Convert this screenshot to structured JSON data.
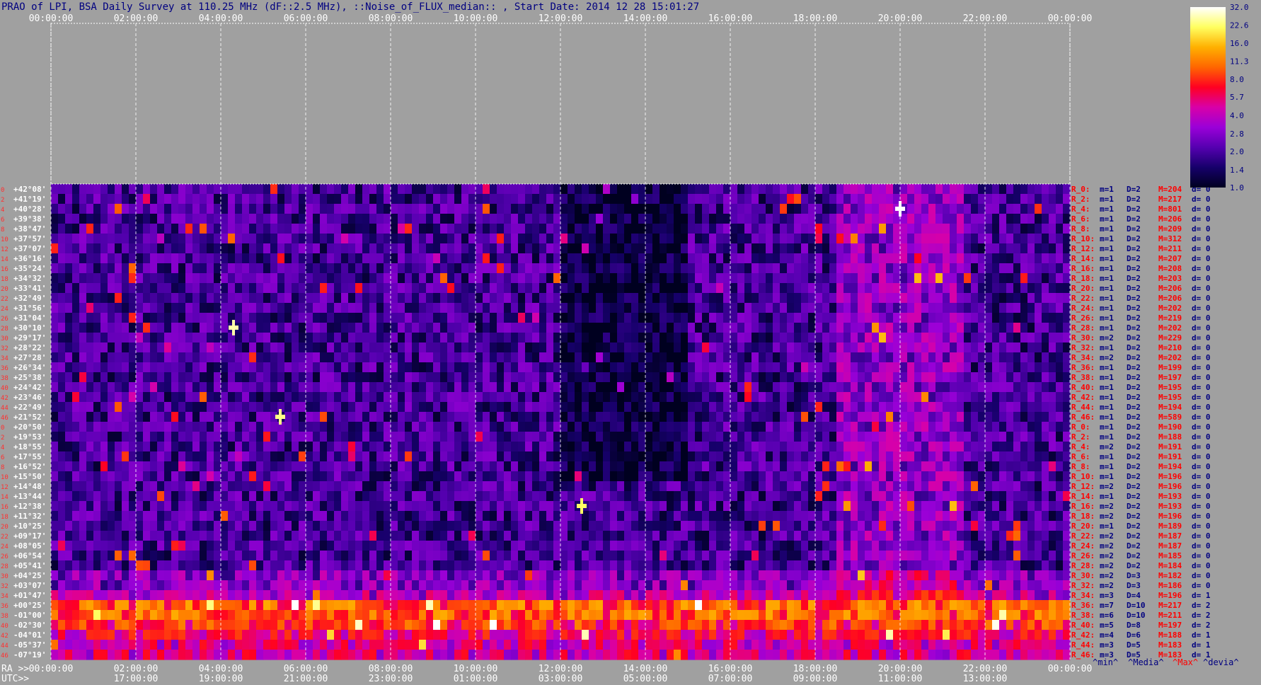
{
  "title": "PRAO of LPI, BSA Daily Survey at 110.25 MHz (dF::2.5 MHz), ::Noise_of_FLUX_median:: , Start Date: 2014 12 28 15:01:27",
  "axis_labels": {
    "ra": "RA >>",
    "utc": "UTC>>",
    "stats_min": "^min^",
    "stats_median": "^Media^",
    "stats_max": "^Max^",
    "stats_dev": "^devia^"
  },
  "colors": {
    "background": "#a0a0a0",
    "text_dark": "#000080",
    "text_red": "#ff0000",
    "text_white": "#ffffff",
    "grid": "#ffffff"
  },
  "chart_data": {
    "type": "heatmap",
    "x_ra_ticks": [
      "00:00:00",
      "02:00:00",
      "04:00:00",
      "06:00:00",
      "08:00:00",
      "10:00:00",
      "12:00:00",
      "14:00:00",
      "16:00:00",
      "18:00:00",
      "20:00:00",
      "22:00:00",
      "00:00:00"
    ],
    "x_ra_hours": [
      0,
      2,
      4,
      6,
      8,
      10,
      12,
      14,
      16,
      18,
      20,
      22,
      24
    ],
    "x_utc_ticks": [
      "17:00:00",
      "19:00:00",
      "21:00:00",
      "23:00:00",
      "01:00:00",
      "03:00:00",
      "05:00:00",
      "07:00:00",
      "09:00:00",
      "11:00:00",
      "13:00:00"
    ],
    "x_utc_ra_hours": [
      2,
      4,
      6,
      8,
      10,
      12,
      14,
      16,
      18,
      20,
      22
    ],
    "xlim": [
      0,
      24
    ],
    "colorbar": {
      "min": 1.0,
      "max": 32.0,
      "scale": "log",
      "labels": [
        "32.0",
        "22.6",
        "16.0",
        "11.3",
        "8.0",
        "5.7",
        "4.0",
        "2.8",
        "2.0",
        "1.4",
        "1.0"
      ],
      "label_values": [
        32.0,
        22.6,
        16.0,
        11.3,
        8.0,
        5.7,
        4.0,
        2.8,
        2.0,
        1.4,
        1.0
      ],
      "stops": [
        "#000020",
        "#16006a",
        "#5500b0",
        "#9a00d8",
        "#d800a8",
        "#ff0022",
        "#ff6600",
        "#ffb000",
        "#ffff60",
        "#ffffff"
      ]
    },
    "rows": [
      {
        "index": "0",
        "dec": "+42°08'",
        "beam": "R_0:",
        "min": "m=1",
        "med": "D=2",
        "max": "M=204",
        "dev": "d= 0"
      },
      {
        "index": "2",
        "dec": "+41°19'",
        "beam": "R_2:",
        "min": "m=1",
        "med": "D=2",
        "max": "M=217",
        "dev": "d= 0"
      },
      {
        "index": "4",
        "dec": "+40°28'",
        "beam": "R_4:",
        "min": "m=1",
        "med": "D=2",
        "max": "M=801",
        "dev": "d= 0"
      },
      {
        "index": "6",
        "dec": "+39°38'",
        "beam": "R_6:",
        "min": "m=1",
        "med": "D=2",
        "max": "M=206",
        "dev": "d= 0"
      },
      {
        "index": "8",
        "dec": "+38°47'",
        "beam": "R_8:",
        "min": "m=1",
        "med": "D=2",
        "max": "M=209",
        "dev": "d= 0"
      },
      {
        "index": "10",
        "dec": "+37°57'",
        "beam": "R_10:",
        "min": "m=1",
        "med": "D=2",
        "max": "M=312",
        "dev": "d= 0"
      },
      {
        "index": "12",
        "dec": "+37°07'",
        "beam": "R_12:",
        "min": "m=1",
        "med": "D=2",
        "max": "M=211",
        "dev": "d= 0"
      },
      {
        "index": "14",
        "dec": "+36°16'",
        "beam": "R_14:",
        "min": "m=1",
        "med": "D=2",
        "max": "M=207",
        "dev": "d= 0"
      },
      {
        "index": "16",
        "dec": "+35°24'",
        "beam": "R_16:",
        "min": "m=1",
        "med": "D=2",
        "max": "M=208",
        "dev": "d= 0"
      },
      {
        "index": "18",
        "dec": "+34°32'",
        "beam": "R_18:",
        "min": "m=1",
        "med": "D=2",
        "max": "M=203",
        "dev": "d= 0"
      },
      {
        "index": "20",
        "dec": "+33°41'",
        "beam": "R_20:",
        "min": "m=1",
        "med": "D=2",
        "max": "M=206",
        "dev": "d= 0"
      },
      {
        "index": "22",
        "dec": "+32°49'",
        "beam": "R_22:",
        "min": "m=1",
        "med": "D=2",
        "max": "M=206",
        "dev": "d= 0"
      },
      {
        "index": "24",
        "dec": "+31°56'",
        "beam": "R_24:",
        "min": "m=1",
        "med": "D=2",
        "max": "M=202",
        "dev": "d= 0"
      },
      {
        "index": "26",
        "dec": "+31°04'",
        "beam": "R_26:",
        "min": "m=1",
        "med": "D=2",
        "max": "M=219",
        "dev": "d= 0"
      },
      {
        "index": "28",
        "dec": "+30°10'",
        "beam": "R_28:",
        "min": "m=1",
        "med": "D=2",
        "max": "M=202",
        "dev": "d= 0"
      },
      {
        "index": "30",
        "dec": "+29°17'",
        "beam": "R_30:",
        "min": "m=2",
        "med": "D=2",
        "max": "M=229",
        "dev": "d= 0"
      },
      {
        "index": "32",
        "dec": "+28°22'",
        "beam": "R_32:",
        "min": "m=1",
        "med": "D=2",
        "max": "M=210",
        "dev": "d= 0"
      },
      {
        "index": "34",
        "dec": "+27°28'",
        "beam": "R_34:",
        "min": "m=2",
        "med": "D=2",
        "max": "M=202",
        "dev": "d= 0"
      },
      {
        "index": "36",
        "dec": "+26°34'",
        "beam": "R_36:",
        "min": "m=1",
        "med": "D=2",
        "max": "M=199",
        "dev": "d= 0"
      },
      {
        "index": "38",
        "dec": "+25°38'",
        "beam": "R_38:",
        "min": "m=1",
        "med": "D=2",
        "max": "M=197",
        "dev": "d= 0"
      },
      {
        "index": "40",
        "dec": "+24°42'",
        "beam": "R_40:",
        "min": "m=1",
        "med": "D=2",
        "max": "M=195",
        "dev": "d= 0"
      },
      {
        "index": "42",
        "dec": "+23°46'",
        "beam": "R_42:",
        "min": "m=1",
        "med": "D=2",
        "max": "M=195",
        "dev": "d= 0"
      },
      {
        "index": "44",
        "dec": "+22°49'",
        "beam": "R_44:",
        "min": "m=1",
        "med": "D=2",
        "max": "M=194",
        "dev": "d= 0"
      },
      {
        "index": "46",
        "dec": "+21°52'",
        "beam": "R_46:",
        "min": "m=1",
        "med": "D=2",
        "max": "M=589",
        "dev": "d= 0"
      },
      {
        "index": "0",
        "dec": "+20°50'",
        "beam": "R_0:",
        "min": "m=1",
        "med": "D=2",
        "max": "M=190",
        "dev": "d= 0"
      },
      {
        "index": "2",
        "dec": "+19°53'",
        "beam": "R_2:",
        "min": "m=1",
        "med": "D=2",
        "max": "M=188",
        "dev": "d= 0"
      },
      {
        "index": "4",
        "dec": "+18°55'",
        "beam": "R_4:",
        "min": "m=2",
        "med": "D=2",
        "max": "M=191",
        "dev": "d= 0"
      },
      {
        "index": "6",
        "dec": "+17°55'",
        "beam": "R_6:",
        "min": "m=1",
        "med": "D=2",
        "max": "M=191",
        "dev": "d= 0"
      },
      {
        "index": "8",
        "dec": "+16°52'",
        "beam": "R_8:",
        "min": "m=1",
        "med": "D=2",
        "max": "M=194",
        "dev": "d= 0"
      },
      {
        "index": "10",
        "dec": "+15°50'",
        "beam": "R_10:",
        "min": "m=1",
        "med": "D=2",
        "max": "M=196",
        "dev": "d= 0"
      },
      {
        "index": "12",
        "dec": "+14°48'",
        "beam": "R_12:",
        "min": "m=2",
        "med": "D=2",
        "max": "M=196",
        "dev": "d= 0"
      },
      {
        "index": "14",
        "dec": "+13°44'",
        "beam": "R_14:",
        "min": "m=1",
        "med": "D=2",
        "max": "M=193",
        "dev": "d= 0"
      },
      {
        "index": "16",
        "dec": "+12°38'",
        "beam": "R_16:",
        "min": "m=2",
        "med": "D=2",
        "max": "M=193",
        "dev": "d= 0"
      },
      {
        "index": "18",
        "dec": "+11°32'",
        "beam": "R_18:",
        "min": "m=2",
        "med": "D=2",
        "max": "M=196",
        "dev": "d= 0"
      },
      {
        "index": "20",
        "dec": "+10°25'",
        "beam": "R_20:",
        "min": "m=1",
        "med": "D=2",
        "max": "M=189",
        "dev": "d= 0"
      },
      {
        "index": "22",
        "dec": "+09°17'",
        "beam": "R_22:",
        "min": "m=2",
        "med": "D=2",
        "max": "M=187",
        "dev": "d= 0"
      },
      {
        "index": "24",
        "dec": "+08°05'",
        "beam": "R_24:",
        "min": "m=2",
        "med": "D=2",
        "max": "M=187",
        "dev": "d= 0"
      },
      {
        "index": "26",
        "dec": "+06°54'",
        "beam": "R_26:",
        "min": "m=2",
        "med": "D=2",
        "max": "M=185",
        "dev": "d= 0"
      },
      {
        "index": "28",
        "dec": "+05°41'",
        "beam": "R_28:",
        "min": "m=2",
        "med": "D=2",
        "max": "M=184",
        "dev": "d= 0"
      },
      {
        "index": "30",
        "dec": "+04°25'",
        "beam": "R_30:",
        "min": "m=2",
        "med": "D=3",
        "max": "M=182",
        "dev": "d= 0"
      },
      {
        "index": "32",
        "dec": "+03°07'",
        "beam": "R_32:",
        "min": "m=2",
        "med": "D=3",
        "max": "M=186",
        "dev": "d= 0"
      },
      {
        "index": "34",
        "dec": "+01°47'",
        "beam": "R_34:",
        "min": "m=3",
        "med": "D=4",
        "max": "M=196",
        "dev": "d= 1"
      },
      {
        "index": "36",
        "dec": "+00°25'",
        "beam": "R_36:",
        "min": "m=7",
        "med": "D=10",
        "max": "M=217",
        "dev": "d= 2"
      },
      {
        "index": "38",
        "dec": "-01°00'",
        "beam": "R_38:",
        "min": "m=6",
        "med": "D=10",
        "max": "M=211",
        "dev": "d= 2"
      },
      {
        "index": "40",
        "dec": "-02°30'",
        "beam": "R_40:",
        "min": "m=5",
        "med": "D=8",
        "max": "M=197",
        "dev": "d= 2"
      },
      {
        "index": "42",
        "dec": "-04°01'",
        "beam": "R_42:",
        "min": "m=4",
        "med": "D=6",
        "max": "M=188",
        "dev": "d= 1"
      },
      {
        "index": "44",
        "dec": "-05°37'",
        "beam": "R_44:",
        "min": "m=3",
        "med": "D=5",
        "max": "M=183",
        "dev": "d= 1"
      },
      {
        "index": "46",
        "dec": "-07°19'",
        "beam": "R_46:",
        "min": "m=3",
        "med": "D=5",
        "max": "M=183",
        "dev": "d= 1"
      }
    ],
    "sources": [
      {
        "name": "",
        "ra": 20.0,
        "row": 2,
        "intensity": 32
      },
      {
        "name": "",
        "ra": 4.3,
        "row": 14,
        "intensity": 26
      },
      {
        "name": "",
        "ra": 5.4,
        "row": 23,
        "intensity": 24
      },
      {
        "name": "",
        "ra": 12.5,
        "row": 32,
        "intensity": 22
      }
    ]
  }
}
